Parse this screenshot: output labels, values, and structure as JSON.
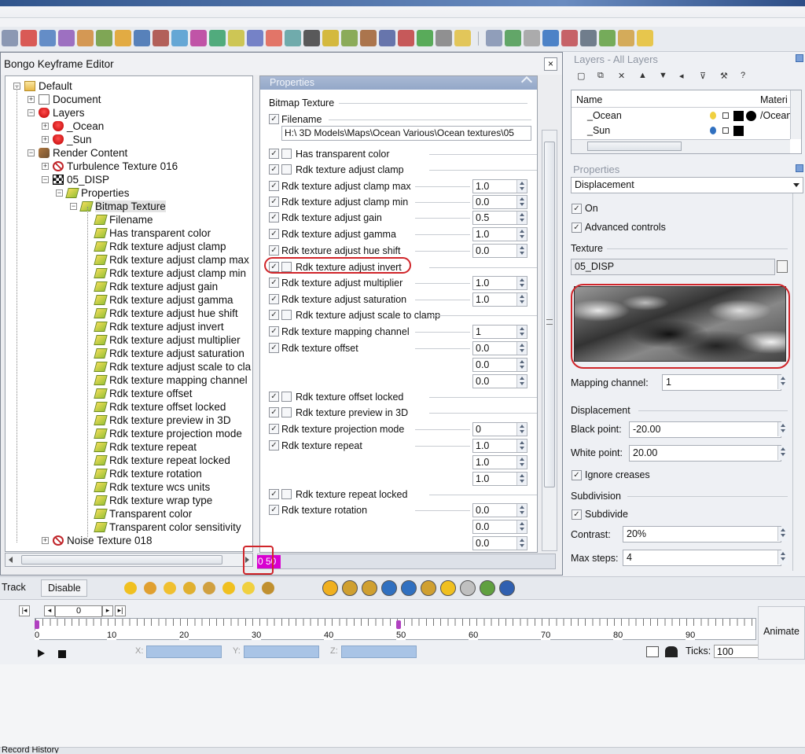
{
  "bke": {
    "title": "Bongo Keyframe Editor",
    "close": "×",
    "status_value": "0 50",
    "tree": [
      {
        "label": "Default",
        "depth": 0,
        "icon": "folder-icon",
        "exp": "−"
      },
      {
        "label": "Document",
        "depth": 1,
        "icon": "document-icon",
        "exp": "+"
      },
      {
        "label": "Layers",
        "depth": 1,
        "icon": "heart-icon",
        "exp": "−"
      },
      {
        "label": "_Ocean",
        "depth": 2,
        "icon": "heart-icon",
        "exp": "+"
      },
      {
        "label": "_Sun",
        "depth": 2,
        "icon": "heart-icon",
        "exp": "+"
      },
      {
        "label": "Render Content",
        "depth": 1,
        "icon": "render-icon",
        "exp": "−"
      },
      {
        "label": "Turbulence Texture 016",
        "depth": 2,
        "icon": "ban-icon",
        "exp": "+"
      },
      {
        "label": "05_DISP",
        "depth": 2,
        "icon": "checker-icon",
        "exp": "−"
      },
      {
        "label": "Properties",
        "depth": 3,
        "icon": "tag-icon",
        "exp": "−"
      },
      {
        "label": "Bitmap Texture",
        "depth": 4,
        "icon": "tag-icon",
        "exp": "−",
        "selected": true
      },
      {
        "label": "Filename",
        "depth": 5,
        "icon": "tag-icon"
      },
      {
        "label": "Has transparent color",
        "depth": 5,
        "icon": "tag-icon"
      },
      {
        "label": "Rdk texture adjust clamp",
        "depth": 5,
        "icon": "tag-icon"
      },
      {
        "label": "Rdk texture adjust clamp max",
        "depth": 5,
        "icon": "tag-icon"
      },
      {
        "label": "Rdk texture adjust clamp min",
        "depth": 5,
        "icon": "tag-icon"
      },
      {
        "label": "Rdk texture adjust gain",
        "depth": 5,
        "icon": "tag-icon"
      },
      {
        "label": "Rdk texture adjust gamma",
        "depth": 5,
        "icon": "tag-icon"
      },
      {
        "label": "Rdk texture adjust hue shift",
        "depth": 5,
        "icon": "tag-icon"
      },
      {
        "label": "Rdk texture adjust invert",
        "depth": 5,
        "icon": "tag-icon"
      },
      {
        "label": "Rdk texture adjust multiplier",
        "depth": 5,
        "icon": "tag-icon"
      },
      {
        "label": "Rdk texture adjust saturation",
        "depth": 5,
        "icon": "tag-icon"
      },
      {
        "label": "Rdk texture adjust scale to cla",
        "depth": 5,
        "icon": "tag-icon"
      },
      {
        "label": "Rdk texture mapping channel",
        "depth": 5,
        "icon": "tag-icon"
      },
      {
        "label": "Rdk texture offset",
        "depth": 5,
        "icon": "tag-icon"
      },
      {
        "label": "Rdk texture offset locked",
        "depth": 5,
        "icon": "tag-icon"
      },
      {
        "label": "Rdk texture preview in 3D",
        "depth": 5,
        "icon": "tag-icon"
      },
      {
        "label": "Rdk texture projection mode",
        "depth": 5,
        "icon": "tag-icon"
      },
      {
        "label": "Rdk texture repeat",
        "depth": 5,
        "icon": "tag-icon"
      },
      {
        "label": "Rdk texture repeat locked",
        "depth": 5,
        "icon": "tag-icon"
      },
      {
        "label": "Rdk texture rotation",
        "depth": 5,
        "icon": "tag-icon"
      },
      {
        "label": "Rdk texture wcs units",
        "depth": 5,
        "icon": "tag-icon"
      },
      {
        "label": "Rdk texture wrap type",
        "depth": 5,
        "icon": "tag-icon"
      },
      {
        "label": "Transparent color",
        "depth": 5,
        "icon": "tag-icon"
      },
      {
        "label": "Transparent color sensitivity",
        "depth": 5,
        "icon": "tag-icon"
      },
      {
        "label": "Noise Texture 018",
        "depth": 2,
        "icon": "ban-icon",
        "exp": "+"
      }
    ],
    "props": {
      "header": "Properties",
      "section": "Bitmap Texture",
      "filename_label": "Filename",
      "filename_value": "H:\\  3D Models\\Maps\\Ocean Various\\Ocean textures\\05",
      "rows": [
        {
          "label": "Has transparent color",
          "cb2": true,
          "values": []
        },
        {
          "label": "Rdk texture adjust clamp",
          "cb2": true,
          "values": []
        },
        {
          "label": "Rdk texture adjust clamp max",
          "values": [
            "1.0"
          ]
        },
        {
          "label": "Rdk texture adjust clamp min",
          "values": [
            "0.0"
          ]
        },
        {
          "label": "Rdk texture adjust gain",
          "values": [
            "0.5"
          ]
        },
        {
          "label": "Rdk texture adjust gamma",
          "values": [
            "1.0"
          ]
        },
        {
          "label": "Rdk texture adjust hue shift",
          "values": [
            "0.0"
          ]
        },
        {
          "label": "Rdk texture adjust invert",
          "cb2": true,
          "values": [],
          "highlight": true
        },
        {
          "label": "Rdk texture adjust multiplier",
          "values": [
            "1.0"
          ]
        },
        {
          "label": "Rdk texture adjust saturation",
          "values": [
            "1.0"
          ]
        },
        {
          "label": "Rdk texture adjust scale to clamp",
          "cb2": true,
          "values": []
        },
        {
          "label": "Rdk texture mapping channel",
          "values": [
            "1"
          ]
        },
        {
          "label": "Rdk texture offset",
          "values": [
            "0.0",
            "0.0",
            "0.0"
          ]
        },
        {
          "label": "Rdk texture offset locked",
          "cb2": true,
          "values": []
        },
        {
          "label": "Rdk texture preview in 3D",
          "cb2": true,
          "values": []
        },
        {
          "label": "Rdk texture projection mode",
          "values": [
            "0"
          ]
        },
        {
          "label": "Rdk texture repeat",
          "values": [
            "1.0",
            "1.0",
            "1.0"
          ]
        },
        {
          "label": "Rdk texture repeat locked",
          "cb2": true,
          "values": []
        },
        {
          "label": "Rdk texture rotation",
          "values": [
            "0.0",
            "0.0",
            "0.0"
          ]
        }
      ]
    }
  },
  "layers": {
    "title": "Layers - All Layers",
    "col_name": "Name",
    "col_material": "Materi",
    "rows": [
      {
        "name": "_Ocean",
        "material": "/Ocean"
      },
      {
        "name": "_Sun",
        "material": ""
      }
    ]
  },
  "rprops": {
    "title": "Properties",
    "dropdown": "Displacement",
    "on": "On",
    "advanced": "Advanced controls",
    "texture_label": "Texture",
    "texture_value": "05_DISP",
    "mapping_label": "Mapping channel:",
    "mapping_value": "1",
    "disp_header": "Displacement",
    "black_label": "Black point:",
    "black_value": "-20.00",
    "white_label": "White point:",
    "white_value": "20.00",
    "ignore": "Ignore creases",
    "subdiv_header": "Subdivision",
    "subdivide": "Subdivide",
    "contrast_label": "Contrast:",
    "contrast_value": "20%",
    "max_label": "Max steps:",
    "max_value": "4"
  },
  "bottom": {
    "track": "Track",
    "disable": "Disable"
  },
  "timeline": {
    "frame": "0",
    "ticks_label": "Ticks:",
    "ticks_value": "100",
    "animate": "Animate",
    "x_label": "X:",
    "y_label": "Y:",
    "z_label": "Z:",
    "scale": [
      "0",
      "10",
      "20",
      "30",
      "40",
      "50",
      "60",
      "70",
      "80",
      "90"
    ],
    "keyframes": [
      0,
      50
    ]
  },
  "status": {
    "text": "Record History"
  }
}
